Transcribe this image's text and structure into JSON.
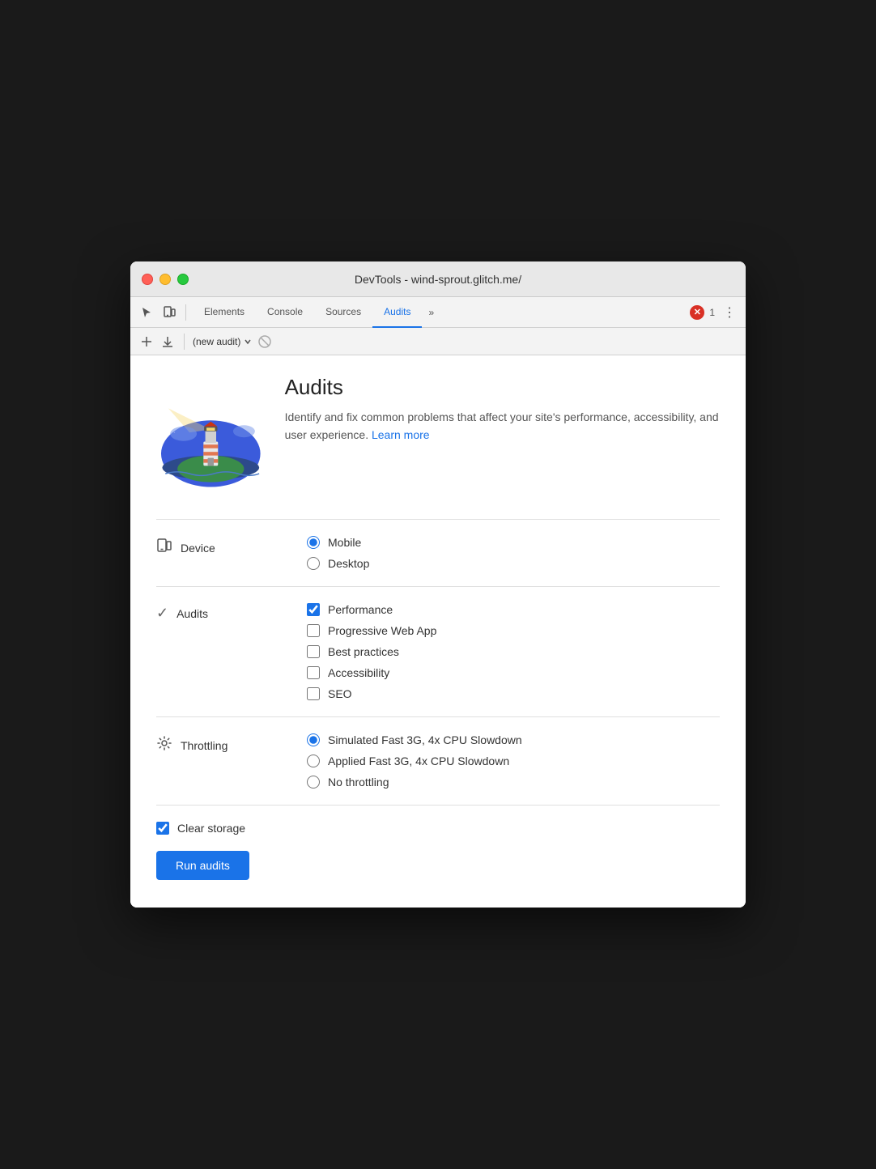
{
  "window": {
    "title": "DevTools - wind-sprout.glitch.me/"
  },
  "tabs": [
    {
      "id": "elements",
      "label": "Elements",
      "active": false
    },
    {
      "id": "console",
      "label": "Console",
      "active": false
    },
    {
      "id": "sources",
      "label": "Sources",
      "active": false
    },
    {
      "id": "audits",
      "label": "Audits",
      "active": true
    }
  ],
  "more_tabs_label": "»",
  "error_count": "1",
  "subtoolbar": {
    "new_audit_label": "(new audit)"
  },
  "hero": {
    "title": "Audits",
    "description": "Identify and fix common problems that affect your site's performance, accessibility, and user experience.",
    "learn_more": "Learn more"
  },
  "device": {
    "label": "Device",
    "options": [
      {
        "id": "mobile",
        "label": "Mobile",
        "checked": true
      },
      {
        "id": "desktop",
        "label": "Desktop",
        "checked": false
      }
    ]
  },
  "audits": {
    "label": "Audits",
    "options": [
      {
        "id": "performance",
        "label": "Performance",
        "checked": true
      },
      {
        "id": "pwa",
        "label": "Progressive Web App",
        "checked": false
      },
      {
        "id": "best-practices",
        "label": "Best practices",
        "checked": false
      },
      {
        "id": "accessibility",
        "label": "Accessibility",
        "checked": false
      },
      {
        "id": "seo",
        "label": "SEO",
        "checked": false
      }
    ]
  },
  "throttling": {
    "label": "Throttling",
    "options": [
      {
        "id": "simulated",
        "label": "Simulated Fast 3G, 4x CPU Slowdown",
        "checked": true
      },
      {
        "id": "applied",
        "label": "Applied Fast 3G, 4x CPU Slowdown",
        "checked": false
      },
      {
        "id": "none",
        "label": "No throttling",
        "checked": false
      }
    ]
  },
  "clear_storage": {
    "label": "Clear storage",
    "checked": true
  },
  "run_button": {
    "label": "Run audits"
  }
}
